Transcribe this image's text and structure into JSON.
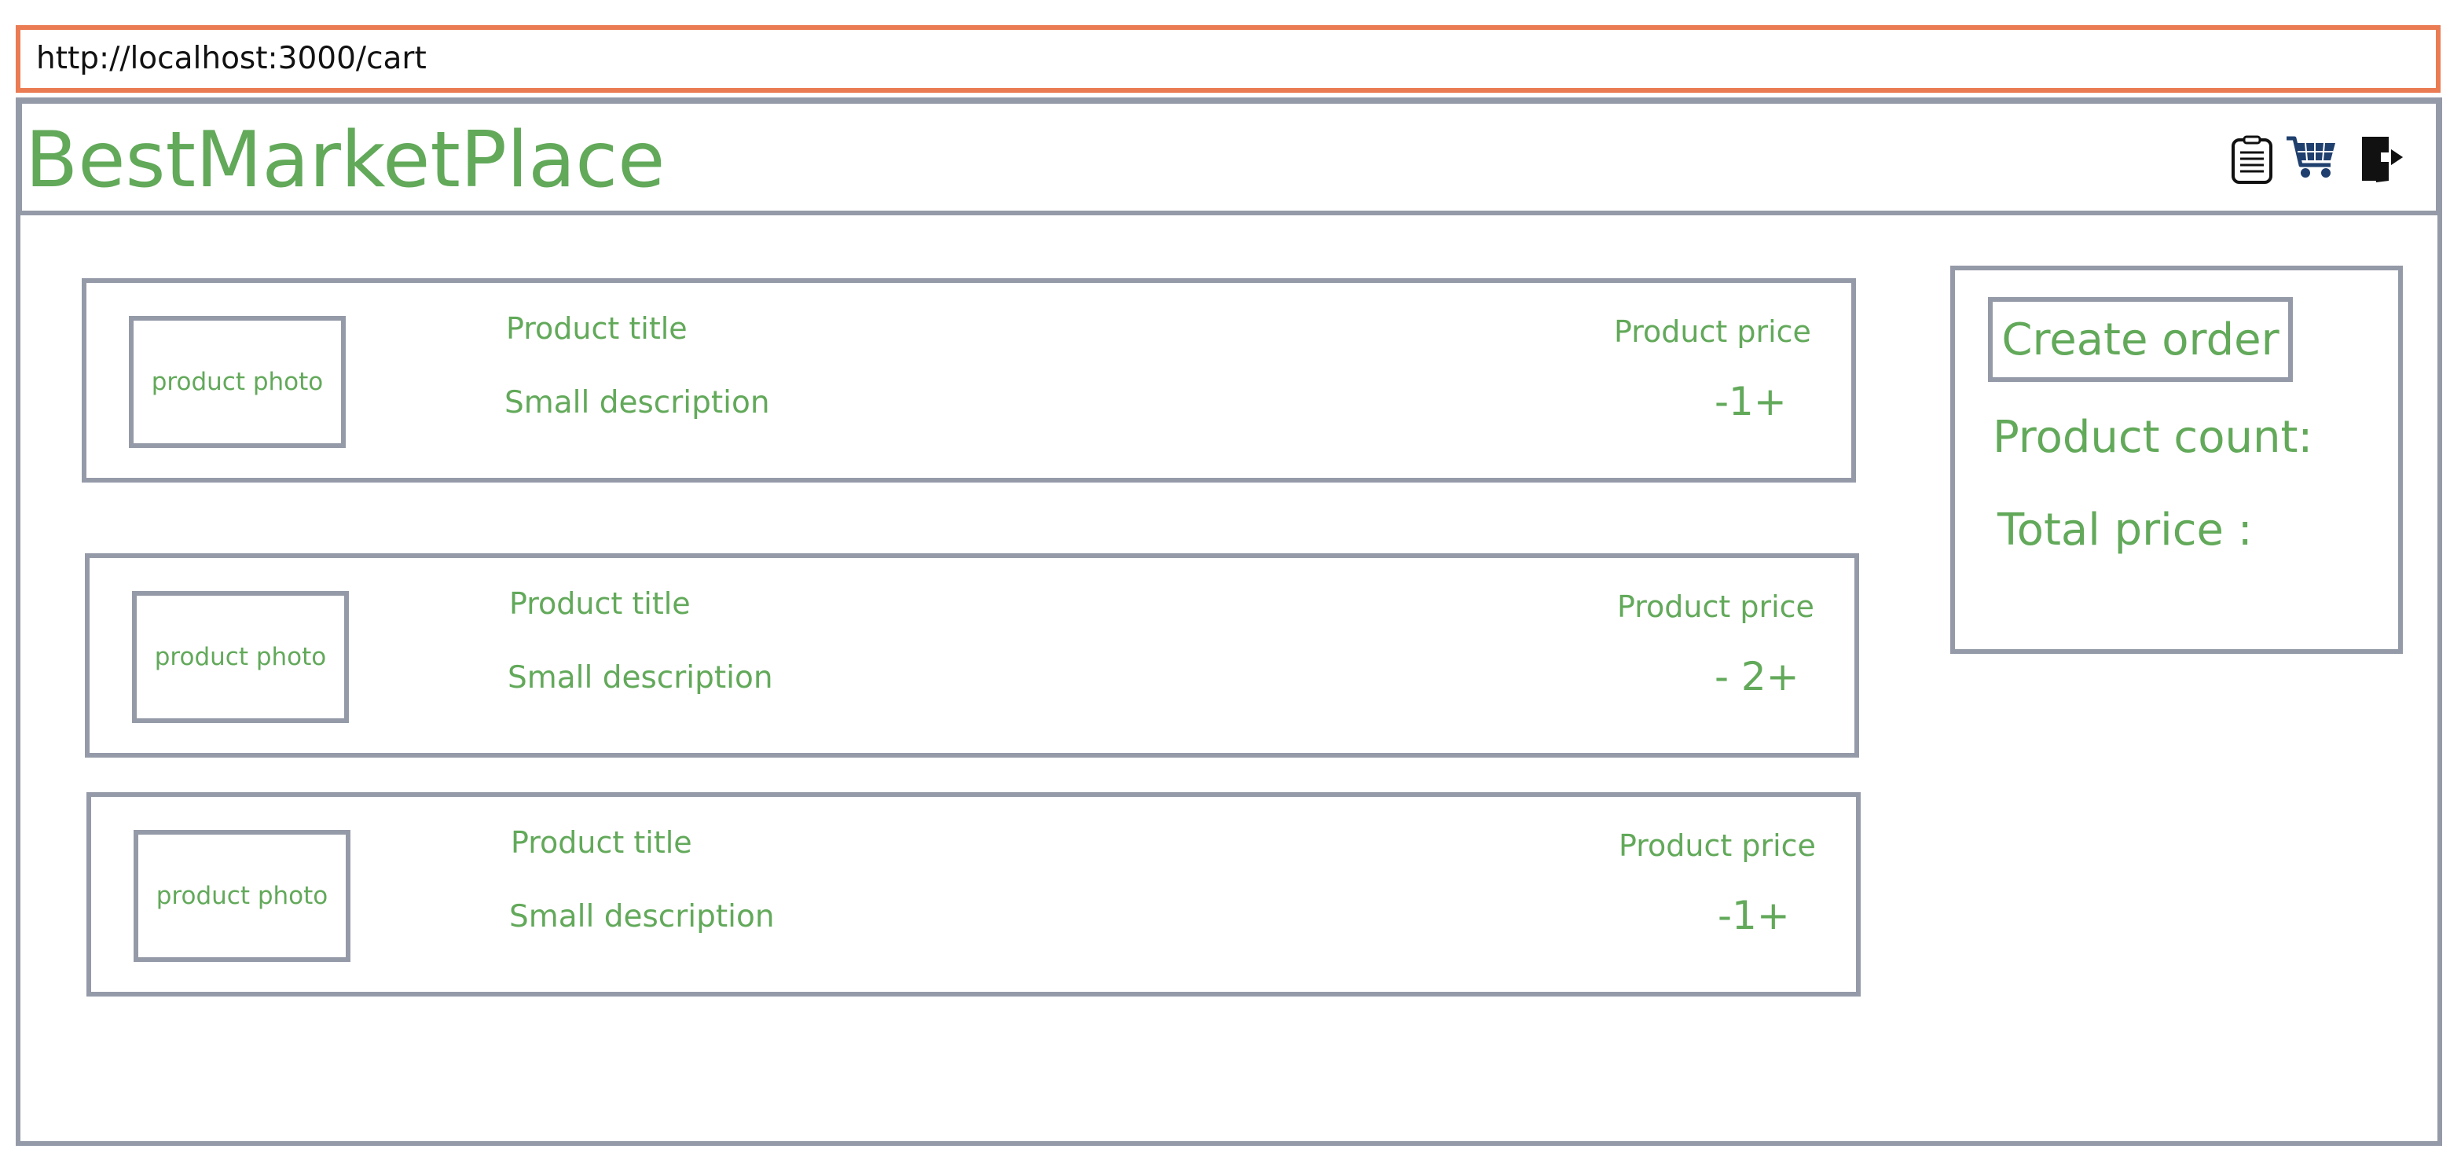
{
  "browser": {
    "url": "http://localhost:3000/cart"
  },
  "header": {
    "logo": "BestMarketPlace",
    "icons": [
      "orders-list-icon",
      "cart-icon",
      "logout-icon"
    ]
  },
  "cart": {
    "items": [
      {
        "photo": "product photo",
        "title": "Product title",
        "description": "Small description",
        "price": "Product price",
        "quantity": "-1+"
      },
      {
        "photo": "product photo",
        "title": "Product title",
        "description": "Small description",
        "price": "Product price",
        "quantity": "- 2+"
      },
      {
        "photo": "product photo",
        "title": "Product title",
        "description": "Small description",
        "price": "Product price",
        "quantity": "-1+"
      }
    ]
  },
  "summary": {
    "create_order": "Create order",
    "product_count_label": "Product count:",
    "total_price_label": "Total price :"
  },
  "colors": {
    "accent_text": "#62a95a",
    "border": "#959aa8",
    "url_border": "#ea7b52",
    "cart_icon": "#1f3f6e"
  }
}
